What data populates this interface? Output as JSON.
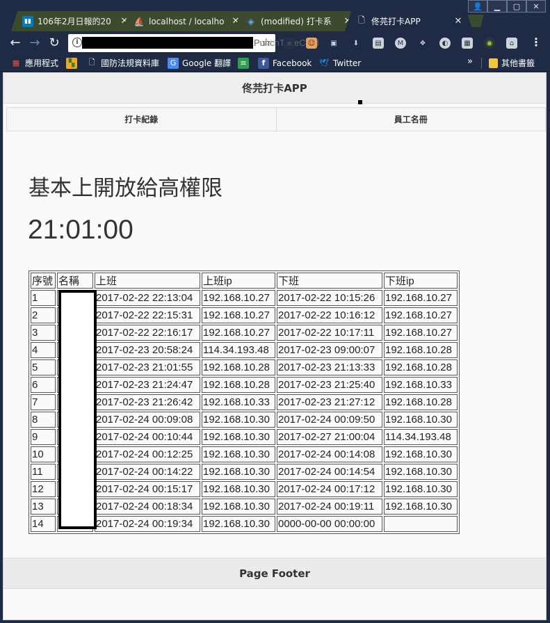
{
  "browser": {
    "tabs": [
      {
        "title": "106年2月日報的20",
        "icon": "trello-icon",
        "color": "#0079bf"
      },
      {
        "title": "localhost / localho",
        "icon": "phpmyadmin-icon",
        "color": "#f29111"
      },
      {
        "title": "(modified) 打卡系",
        "icon": "stackedit-icon",
        "color": "#3a7bd5"
      },
      {
        "title": "佟芫打卡APP",
        "icon": "page-icon",
        "color": "#ffffff",
        "active": true
      }
    ],
    "url_visible": "PunchTimeCard",
    "bookmarks": [
      {
        "label": "應用程式",
        "icon": "apps-grid-icon"
      },
      {
        "label": "",
        "icon": "photo-bookmark-icon"
      },
      {
        "label": "國防法規資料庫",
        "icon": "page-icon"
      },
      {
        "label": "Google 翻譯",
        "icon": "google-translate-icon"
      },
      {
        "label": "",
        "icon": "green-bookmark-icon"
      },
      {
        "label": "Facebook",
        "icon": "facebook-icon"
      },
      {
        "label": "Twitter",
        "icon": "twitter-icon"
      }
    ],
    "other_bookmarks": "其他書籤",
    "overflow": "»"
  },
  "app": {
    "title": "佟芫打卡APP",
    "nav": [
      "打卡紀錄",
      "員工名冊"
    ],
    "heading": "基本上開放給高權限",
    "clock": "21:01:00",
    "footer": "Page Footer"
  },
  "table": {
    "headers": [
      "序號",
      "名稱",
      "上班",
      "上班ip",
      "下班",
      "下班ip"
    ],
    "rows": [
      [
        "1",
        "",
        "2017-02-22 22:13:04",
        "192.168.10.27",
        "2017-02-22 10:15:26",
        "192.168.10.27"
      ],
      [
        "2",
        "",
        "2017-02-22 22:15:31",
        "192.168.10.27",
        "2017-02-22 10:16:12",
        "192.168.10.27"
      ],
      [
        "3",
        "",
        "2017-02-22 22:16:17",
        "192.168.10.27",
        "2017-02-22 10:17:11",
        "192.168.10.27"
      ],
      [
        "4",
        "",
        "2017-02-23 20:58:24",
        "114.34.193.48",
        "2017-02-23 09:00:07",
        "192.168.10.28"
      ],
      [
        "5",
        "",
        "2017-02-23 21:01:55",
        "192.168.10.28",
        "2017-02-23 21:13:33",
        "192.168.10.28"
      ],
      [
        "6",
        "",
        "2017-02-23 21:24:47",
        "192.168.10.28",
        "2017-02-23 21:25:40",
        "192.168.10.33"
      ],
      [
        "7",
        "",
        "2017-02-23 21:26:42",
        "192.168.10.33",
        "2017-02-23 21:27:12",
        "192.168.10.28"
      ],
      [
        "8",
        "",
        "2017-02-24 00:09:08",
        "192.168.10.30",
        "2017-02-24 00:09:50",
        "192.168.10.30"
      ],
      [
        "9",
        "",
        "2017-02-24 00:10:44",
        "192.168.10.30",
        "2017-02-27 21:00:04",
        "114.34.193.48"
      ],
      [
        "10",
        "",
        "2017-02-24 00:12:25",
        "192.168.10.30",
        "2017-02-24 00:14:08",
        "192.168.10.30"
      ],
      [
        "11",
        "",
        "2017-02-24 00:14:22",
        "192.168.10.30",
        "2017-02-24 00:14:54",
        "192.168.10.30"
      ],
      [
        "12",
        "",
        "2017-02-24 00:15:17",
        "192.168.10.30",
        "2017-02-24 00:17:12",
        "192.168.10.30"
      ],
      [
        "13",
        "",
        "2017-02-24 00:18:34",
        "192.168.10.30",
        "2017-02-24 00:19:11",
        "192.168.10.30"
      ],
      [
        "14",
        "",
        "2017-02-24 00:19:34",
        "192.168.10.30",
        "0000-00-00 00:00:00",
        ""
      ]
    ]
  }
}
